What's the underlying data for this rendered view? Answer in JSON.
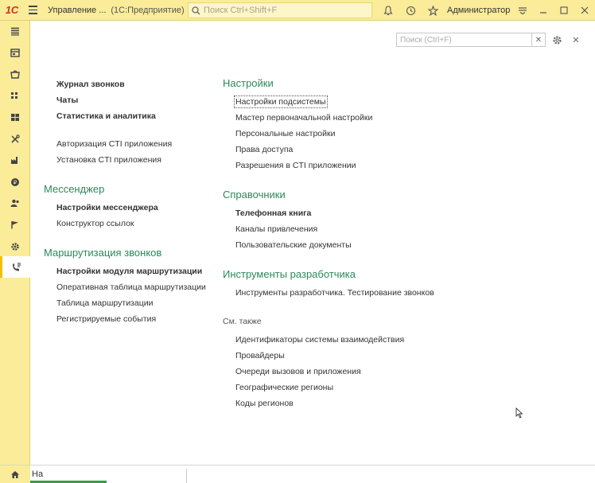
{
  "topbar": {
    "logo": "1С",
    "title": "Управление ...",
    "subtitle": "(1С:Предприятие)",
    "search_placeholder": "Поиск Ctrl+Shift+F",
    "user": "Администратор"
  },
  "main": {
    "search_placeholder": "Поиск (Ctrl+F)",
    "left": {
      "links_top": [
        "Журнал звонков",
        "Чаты",
        "Статистика и аналитика"
      ],
      "links_cti": [
        "Авторизация CTI приложения",
        "Установка CTI приложения"
      ],
      "messenger": {
        "title": "Мессенджер",
        "items": [
          "Настройки мессенджера",
          "Конструктор ссылок"
        ]
      },
      "routing": {
        "title": "Маршрутизация звонков",
        "items": [
          "Настройки модуля маршрутизации",
          "Оперативная таблица маршрутизации",
          "Таблица маршрутизации",
          "Регистрируемые события"
        ]
      }
    },
    "right": {
      "settings": {
        "title": "Настройки",
        "items": [
          "Настройки подсистемы",
          "Мастер первоначальной настройки",
          "Персональные настройки",
          "Права доступа",
          "Разрешения в CTI приложении"
        ]
      },
      "catalogs": {
        "title": "Справочники",
        "items": [
          "Телефонная книга",
          "Каналы привлечения",
          "Пользовательские документы"
        ]
      },
      "devtools": {
        "title": "Инструменты разработчика",
        "items": [
          "Инструменты разработчика. Тестирование звонков"
        ]
      },
      "see_also": {
        "title": "См. также",
        "items": [
          "Идентификаторы системы взаимодействия",
          "Провайдеры",
          "Очереди вызовов и приложения",
          "Географические регионы",
          "Коды регионов"
        ]
      }
    }
  },
  "bottom": {
    "tab_label": "На"
  }
}
